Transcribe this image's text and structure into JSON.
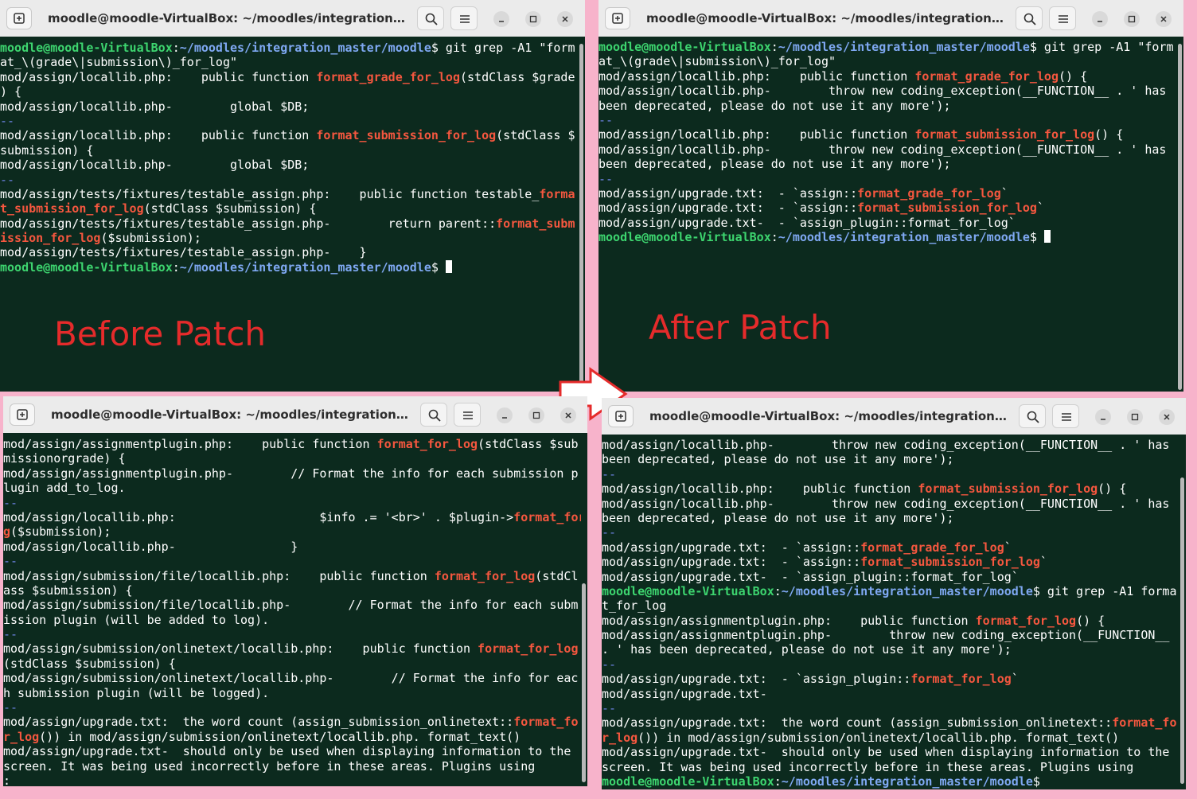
{
  "windows": {
    "tl": {
      "title": "moodle@moodle-VirtualBox: ~/moodles/integration_master...",
      "lines": [
        [
          "moodle@moodle-VirtualBox|u",
          ":|x",
          "~/moodles/integration_master/moodle|p",
          "$ git grep -A1 \"form|x"
        ],
        [
          "at_\\(grade\\|submission\\)_for_log\"|x"
        ],
        [
          "mod/assign/locallib.php|x",
          ":    public function |x",
          "format_grade_for_log|h",
          "(stdClass $grade|x"
        ],
        [
          ") {|x"
        ],
        [
          "mod/assign/locallib.php|x",
          "-        global $DB;|x"
        ],
        [
          "--|s"
        ],
        [
          "mod/assign/locallib.php|x",
          ":    public function |x",
          "format_submission_for_log|h",
          "(stdClass $|x"
        ],
        [
          "submission) {|x"
        ],
        [
          "mod/assign/locallib.php|x",
          "-        global $DB;|x"
        ],
        [
          "--|s"
        ],
        [
          "mod/assign/tests/fixtures/testable_assign.php|x",
          ":    public function testable_|x",
          "forma|h"
        ],
        [
          "t_submission_for_log|h",
          "(stdClass $submission) {|x"
        ],
        [
          "mod/assign/tests/fixtures/testable_assign.php|x",
          "-        return parent::|x",
          "format_subm|h"
        ],
        [
          "ission_for_log|h",
          "($submission);|x"
        ],
        [
          "mod/assign/tests/fixtures/testable_assign.php|x",
          "-    }|x"
        ],
        [
          "moodle@moodle-VirtualBox|u",
          ":|x",
          "~/moodles/integration_master/moodle|p",
          "$ |x",
          "CURSOR|c"
        ]
      ]
    },
    "tr": {
      "title": "moodle@moodle-VirtualBox: ~/moodles/integration_master...",
      "lines": [
        [
          "moodle@moodle-VirtualBox|u",
          ":|x",
          "~/moodles/integration_master/moodle|p",
          "$ git grep -A1 \"form|x"
        ],
        [
          "at_\\(grade\\|submission\\)_for_log\"|x"
        ],
        [
          "mod/assign/locallib.php|x",
          ":    public function |x",
          "format_grade_for_log|h",
          "() {|x"
        ],
        [
          "mod/assign/locallib.php|x",
          "-        throw new coding_exception(__FUNCTION__ . ' has|x"
        ],
        [
          "been deprecated, please do not use it any more');|x"
        ],
        [
          "--|s"
        ],
        [
          "mod/assign/locallib.php|x",
          ":    public function |x",
          "format_submission_for_log|h",
          "() {|x"
        ],
        [
          "mod/assign/locallib.php|x",
          "-        throw new coding_exception(__FUNCTION__ . ' has|x"
        ],
        [
          "been deprecated, please do not use it any more');|x"
        ],
        [
          "--|s"
        ],
        [
          "mod/assign/upgrade.txt|x",
          ":  - `assign::|x",
          "format_grade_for_log|h",
          "`|x"
        ],
        [
          "mod/assign/upgrade.txt|x",
          ":  - `assign::|x",
          "format_submission_for_log|h",
          "`|x"
        ],
        [
          "mod/assign/upgrade.txt|x",
          "-  - `assign_plugin::format_for_log`|x"
        ],
        [
          "moodle@moodle-VirtualBox|u",
          ":|x",
          "~/moodles/integration_master/moodle|p",
          "$ |x",
          "CURSOR|c"
        ]
      ]
    },
    "bl": {
      "title": "moodle@moodle-VirtualBox: ~/moodles/integration_master...",
      "lines": [
        [
          "mod/assign/assignmentplugin.php|x",
          ":    public function |x",
          "format_for_log|h",
          "(stdClass $sub|x"
        ],
        [
          "missionorgrade) {|x"
        ],
        [
          "mod/assign/assignmentplugin.php|x",
          "-        // Format the info for each submission p|x"
        ],
        [
          "lugin add_to_log.|x"
        ],
        [
          "--|s"
        ],
        [
          "mod/assign/locallib.php|x",
          ":                    $info .= '<br>' . $plugin->|x",
          "format_for_lo|h"
        ],
        [
          "g|h",
          "($submission);|x"
        ],
        [
          "mod/assign/locallib.php|x",
          "-                }|x"
        ],
        [
          "--|s"
        ],
        [
          "mod/assign/submission/file/locallib.php|x",
          ":    public function |x",
          "format_for_log|h",
          "(stdCl|x"
        ],
        [
          "ass $submission) {|x"
        ],
        [
          "mod/assign/submission/file/locallib.php|x",
          "-        // Format the info for each subm|x"
        ],
        [
          "ission plugin (will be added to log).|x"
        ],
        [
          "--|s"
        ],
        [
          "mod/assign/submission/onlinetext/locallib.php|x",
          ":    public function |x",
          "format_for_log|h"
        ],
        [
          "(stdClass $submission) {|x"
        ],
        [
          "mod/assign/submission/onlinetext/locallib.php|x",
          "-        // Format the info for eac|x"
        ],
        [
          "h submission plugin (will be logged).|x"
        ],
        [
          "--|s"
        ],
        [
          "mod/assign/upgrade.txt|x",
          ":  the word count (assign_submission_onlinetext::|x",
          "format_fo|h"
        ],
        [
          "r_log|h",
          "()) in mod/assign/submission/onlinetext/locallib.php. format_text()|x"
        ],
        [
          "mod/assign/upgrade.txt|x",
          "-  should only be used when displaying information to the|x"
        ],
        [
          "screen. It was being used incorrectly before in these areas. Plugins using|x"
        ],
        [
          ":|x"
        ]
      ]
    },
    "br": {
      "title": "moodle@moodle-VirtualBox: ~/moodles/integration_master...",
      "lines": [
        [
          "mod/assign/locallib.php|x",
          "-        throw new coding_exception(__FUNCTION__ . ' has|x"
        ],
        [
          "been deprecated, please do not use it any more');|x"
        ],
        [
          "--|s"
        ],
        [
          "mod/assign/locallib.php|x",
          ":    public function |x",
          "format_submission_for_log|h",
          "() {|x"
        ],
        [
          "mod/assign/locallib.php|x",
          "-        throw new coding_exception(__FUNCTION__ . ' has|x"
        ],
        [
          "been deprecated, please do not use it any more');|x"
        ],
        [
          "--|s"
        ],
        [
          "mod/assign/upgrade.txt|x",
          ":  - `assign::|x",
          "format_grade_for_log|h",
          "`|x"
        ],
        [
          "mod/assign/upgrade.txt|x",
          ":  - `assign::|x",
          "format_submission_for_log|h",
          "`|x"
        ],
        [
          "mod/assign/upgrade.txt|x",
          "-  - `assign_plugin::format_for_log`|x"
        ],
        [
          "moodle@moodle-VirtualBox|u",
          ":|x",
          "~/moodles/integration_master/moodle|p",
          "$ git grep -A1 forma|x"
        ],
        [
          "t_for_log|x"
        ],
        [
          "mod/assign/assignmentplugin.php|x",
          ":    public function |x",
          "format_for_log|h",
          "() {|x"
        ],
        [
          "mod/assign/assignmentplugin.php|x",
          "-        throw new coding_exception(__FUNCTION__|x"
        ],
        [
          ". ' has been deprecated, please do not use it any more');|x"
        ],
        [
          "--|s"
        ],
        [
          "mod/assign/upgrade.txt|x",
          ":  - `assign_plugin::|x",
          "format_for_log|h",
          "`|x"
        ],
        [
          "mod/assign/upgrade.txt|x",
          "-|x"
        ],
        [
          "--|s"
        ],
        [
          "mod/assign/upgrade.txt|x",
          ":  the word count (assign_submission_onlinetext::|x",
          "format_fo|h"
        ],
        [
          "r_log|h",
          "()) in mod/assign/submission/onlinetext/locallib.php. format_text()|x"
        ],
        [
          "mod/assign/upgrade.txt|x",
          "-  should only be used when displaying information to the|x"
        ],
        [
          "screen. It was being used incorrectly before in these areas. Plugins using|x"
        ],
        [
          "moodle@moodle-VirtualBox|u",
          ":|x",
          "~/moodles/integration_master/moodle|p",
          "$|x"
        ]
      ]
    }
  },
  "labels": {
    "before": "Before Patch",
    "after": "After Patch"
  },
  "colors": {
    "background": "#f7b3cb",
    "terminal_bg": "#0c2a1e",
    "user": "#3dd56f",
    "path": "#7fa8f2",
    "match": "#f5573f",
    "separator": "#6e84e6",
    "annotation": "#e52b2b"
  }
}
